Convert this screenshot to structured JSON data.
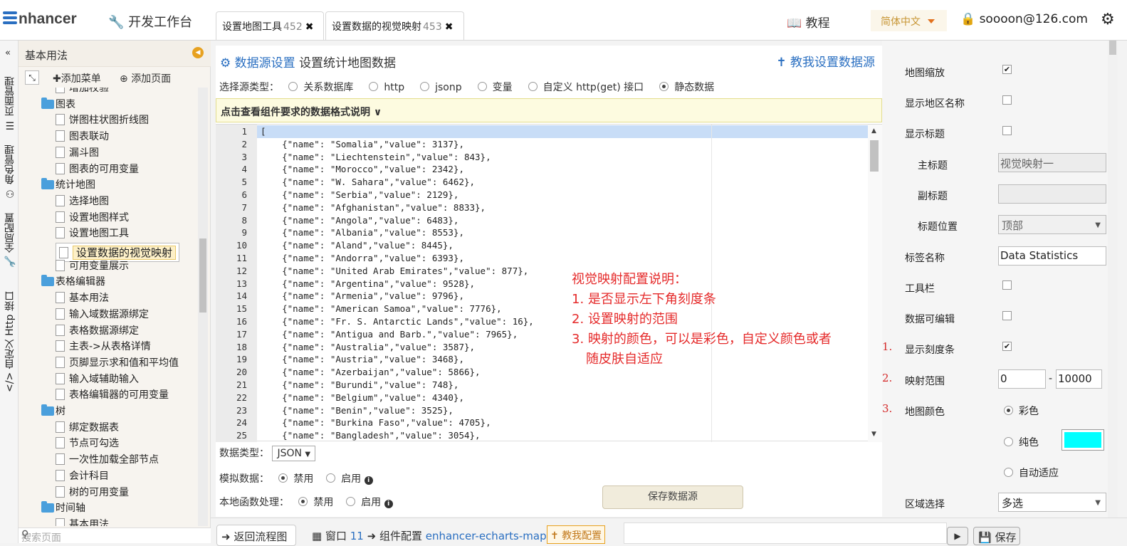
{
  "topbar": {
    "logo": "nhancer",
    "workbench": "开发工作台",
    "tabs": [
      {
        "label": "设置地图工具",
        "num": "452"
      },
      {
        "label": "设置数据的视觉映射",
        "num": "453"
      }
    ],
    "tutorial": "教程",
    "language": "简体中文",
    "user": "soooon@126.com"
  },
  "vertical_tabs": [
    "页面管理",
    "角色管理",
    "全局配置",
    "自定义 Http 接口"
  ],
  "left_panel": {
    "title": "基本用法",
    "add_menu": "添加菜单",
    "add_page": "添加页面",
    "search_placeholder": "搜索页面",
    "tree": [
      {
        "type": "leaf",
        "label": "增加校验"
      },
      {
        "type": "folder",
        "label": "图表"
      },
      {
        "type": "leaf",
        "label": "饼图柱状图折线图"
      },
      {
        "type": "leaf",
        "label": "图表联动"
      },
      {
        "type": "leaf",
        "label": "漏斗图"
      },
      {
        "type": "leaf",
        "label": "图表的可用变量"
      },
      {
        "type": "folder",
        "label": "统计地图"
      },
      {
        "type": "leaf",
        "label": "选择地图"
      },
      {
        "type": "leaf",
        "label": "设置地图样式"
      },
      {
        "type": "leaf",
        "label": "设置地图工具"
      },
      {
        "type": "leaf",
        "label": "设置数据的视觉映射",
        "selected": true
      },
      {
        "type": "leaf",
        "label": "可用变量展示"
      },
      {
        "type": "folder",
        "label": "表格编辑器"
      },
      {
        "type": "leaf",
        "label": "基本用法"
      },
      {
        "type": "leaf",
        "label": "输入域数据源绑定"
      },
      {
        "type": "leaf",
        "label": "表格数据源绑定"
      },
      {
        "type": "leaf",
        "label": "主表->从表格详情"
      },
      {
        "type": "leaf",
        "label": "页脚显示求和值和平均值"
      },
      {
        "type": "leaf",
        "label": "输入域辅助输入"
      },
      {
        "type": "leaf",
        "label": "表格编辑器的可用变量"
      },
      {
        "type": "folder",
        "label": "树"
      },
      {
        "type": "leaf",
        "label": "绑定数据表"
      },
      {
        "type": "leaf",
        "label": "节点可勾选"
      },
      {
        "type": "leaf",
        "label": "一次性加载全部节点"
      },
      {
        "type": "leaf",
        "label": "会计科目"
      },
      {
        "type": "leaf",
        "label": "树的可用变量"
      },
      {
        "type": "folder",
        "label": "时间轴"
      },
      {
        "type": "leaf",
        "label": "基本用法"
      }
    ]
  },
  "center": {
    "title_prefix": "数据源设置",
    "title": "设置统计地图数据",
    "help_link": "教我设置数据源",
    "source_type_label": "选择源类型：",
    "source_types": [
      {
        "label": "关系数据库",
        "checked": false
      },
      {
        "label": "http",
        "checked": false
      },
      {
        "label": "jsonp",
        "checked": false
      },
      {
        "label": "变量",
        "checked": false
      },
      {
        "label": "自定义 http(get) 接口",
        "checked": false
      },
      {
        "label": "静态数据",
        "checked": true
      }
    ],
    "format_hint": "点击查看组件要求的数据格式说明",
    "code_lines": [
      "[",
      "    {\"name\": \"Somalia\",\"value\": 3137},",
      "    {\"name\": \"Liechtenstein\",\"value\": 843},",
      "    {\"name\": \"Morocco\",\"value\": 2342},",
      "    {\"name\": \"W. Sahara\",\"value\": 6462},",
      "    {\"name\": \"Serbia\",\"value\": 2129},",
      "    {\"name\": \"Afghanistan\",\"value\": 8833},",
      "    {\"name\": \"Angola\",\"value\": 6483},",
      "    {\"name\": \"Albania\",\"value\": 8553},",
      "    {\"name\": \"Aland\",\"value\": 8445},",
      "    {\"name\": \"Andorra\",\"value\": 6393},",
      "    {\"name\": \"United Arab Emirates\",\"value\": 877},",
      "    {\"name\": \"Argentina\",\"value\": 9528},",
      "    {\"name\": \"Armenia\",\"value\": 9796},",
      "    {\"name\": \"American Samoa\",\"value\": 7776},",
      "    {\"name\": \"Fr. S. Antarctic Lands\",\"value\": 16},",
      "    {\"name\": \"Antigua and Barb.\",\"value\": 7965},",
      "    {\"name\": \"Australia\",\"value\": 3587},",
      "    {\"name\": \"Austria\",\"value\": 3468},",
      "    {\"name\": \"Azerbaijan\",\"value\": 5866},",
      "    {\"name\": \"Burundi\",\"value\": 748},",
      "    {\"name\": \"Belgium\",\"value\": 4340},",
      "    {\"name\": \"Benin\",\"value\": 3525},",
      "    {\"name\": \"Burkina Faso\",\"value\": 4705},",
      "    {\"name\": \"Bangladesh\",\"value\": 3054},"
    ],
    "note": {
      "heading": "视觉映射配置说明：",
      "items": [
        "1. 是否显示左下角刻度条",
        "2. 设置映射的范围",
        "3. 映射的颜色，可以是彩色，自定义颜色或者",
        "随皮肤自适应"
      ]
    },
    "data_type_label": "数据类型：",
    "data_type_value": "JSON",
    "mock_label": "模拟数据：",
    "local_fn_label": "本地函数处理：",
    "disable": "禁用",
    "enable": "启用",
    "save_button": "保存数据源"
  },
  "right_panel": {
    "map_zoom": "地图缩放",
    "show_region_name": "显示地区名称",
    "show_title": "显示标题",
    "main_title": "主标题",
    "main_title_value": "视觉映射一",
    "sub_title": "副标题",
    "sub_title_value": "",
    "title_position": "标题位置",
    "title_position_value": "顶部",
    "label_name": "标签名称",
    "label_name_value": "Data Statistics",
    "toolbar": "工具栏",
    "data_editable": "数据可编辑",
    "show_scale_bar": "显示刻度条",
    "map_range": "映射范围",
    "range_min": "0",
    "range_max": "10000",
    "range_sep": "-",
    "map_color": "地图颜色",
    "color_colorful": "彩色",
    "color_solid": "纯色",
    "color_auto": "自动适应",
    "solid_color": "#00ffff",
    "region_select": "区域选择",
    "region_select_value": "多选",
    "num1": "1.",
    "num2": "2.",
    "num3": "3."
  },
  "bottombar": {
    "back": "返回流程图",
    "window": "窗口",
    "window_num": "11",
    "component": "组件配置",
    "component_name": "enhancer-echarts-map",
    "teach": "教我配置",
    "save": "保存"
  }
}
